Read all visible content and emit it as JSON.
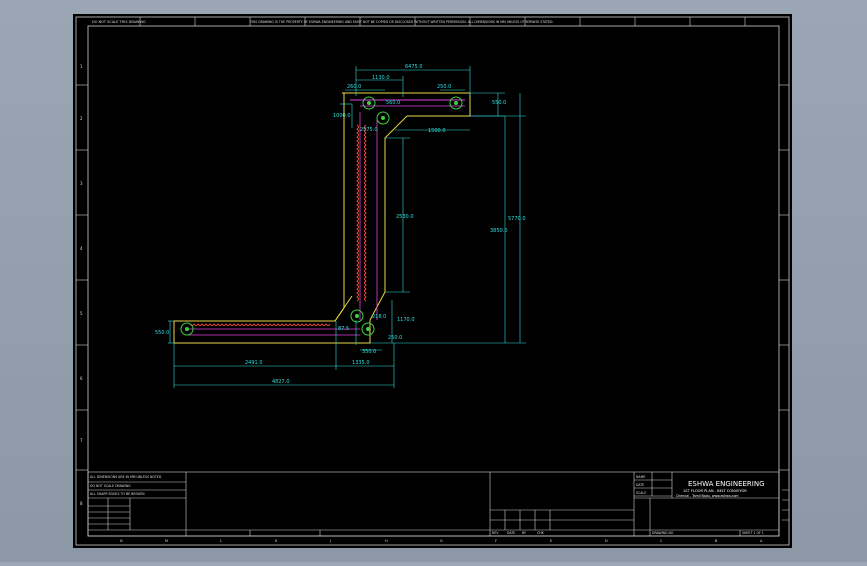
{
  "sheet": {
    "top_left_note": "DO NOT SCALE THIS DRAWING",
    "top_note": "THIS DRAWING IS THE PROPERTY OF ESHWA ENGINEERING AND MUST NOT BE COPIED OR DISCLOSED WITHOUT WRITTEN PERMISSION. ALL DIMENSIONS IN MM UNLESS OTHERWISE STATED.",
    "zone_letters_bottom": [
      "N",
      "M",
      "L",
      "K",
      "J",
      "H",
      "G",
      "F",
      "E",
      "D",
      "C",
      "B",
      "A"
    ],
    "zone_numbers_left": [
      "1",
      "2",
      "3",
      "4",
      "5",
      "6",
      "7",
      "8"
    ]
  },
  "dimensions": {
    "overall_width": "6475.0",
    "top_segment": "1130.0",
    "top_right_small": "250.0",
    "top_left_small": "260.0",
    "mid_small": "560.0",
    "left_side": "1000.0",
    "top_right_height": "550.0",
    "lower_top": "1500.0",
    "inclined": "2575.0",
    "vertical_total": "5770.0",
    "vertical_inner": "3850.0",
    "vertical_mid": "2530.0",
    "left_height": "550.0",
    "bottom_offset": "1170.0",
    "small_a": "87.5",
    "small_b": "218.0",
    "small_c": "250.0",
    "small_d": "350.0",
    "bottom_length": "2491.0",
    "bottom_short": "1335.0",
    "bottom_overall": "4827.0"
  },
  "title_block": {
    "notes": [
      "ALL DIMENSIONS ARE IN MM UNLESS NOTED",
      "DO NOT SCALE DRAWING",
      "ALL SHARP EDGES TO BE BROKEN"
    ],
    "company": "ESHWA ENGINEERING",
    "project_line": "1ST FLOOR PLAN - BELT CONVEYOR",
    "address_line": "Chennai - Tamil Nadu, www.eshwa.com",
    "rev_cells": [
      "REV",
      "DATE",
      "BY",
      "CHK"
    ],
    "labels": [
      "NAME",
      "DATE",
      "SCALE"
    ],
    "sheet_no": "SHEET 1 OF 1",
    "drawing_no": "DRAWING NO"
  }
}
